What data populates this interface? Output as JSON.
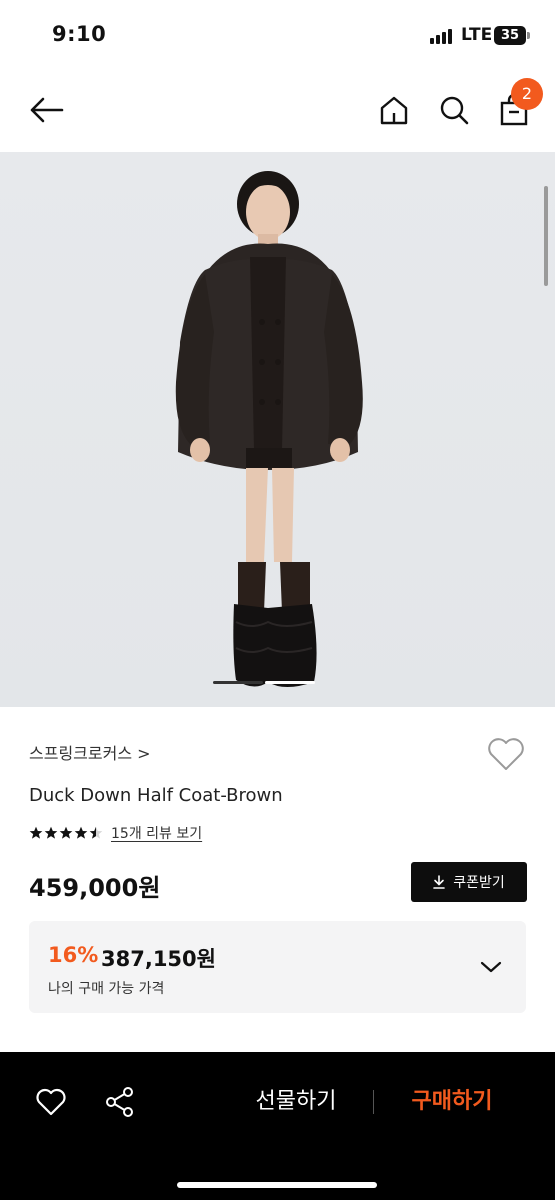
{
  "status_bar": {
    "time": "9:10",
    "carrier": "LTE",
    "battery": "35"
  },
  "nav": {
    "back_icon": "arrow-left-icon",
    "home_icon": "home-icon",
    "search_icon": "search-icon",
    "cart_icon": "shopping-bag-icon",
    "cart_count": "2"
  },
  "gallery": {
    "image": "model wearing dark brown down half coat",
    "slide_index": 1,
    "slide_count": 2
  },
  "product": {
    "brand": "스프링크로커스 >",
    "name": "Duck Down Half Coat-Brown",
    "rating": 4.5,
    "review_link": "15개 리뷰 보기",
    "price": "459,000원",
    "coupon_button": "쿠폰받기"
  },
  "discount": {
    "rate": "16%",
    "price": "387,150원",
    "label": "나의 구매 가능 가격"
  },
  "bottom_bar": {
    "gift_button": "선물하기",
    "buy_button": "구매하기"
  },
  "colors": {
    "accent": "#f25a1e",
    "dark": "#0d0d0d",
    "panel": "#f4f4f5"
  }
}
